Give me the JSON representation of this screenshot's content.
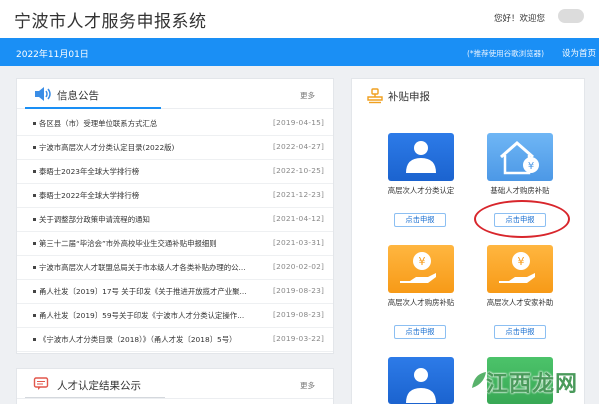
{
  "header": {
    "site_title": "宁波市人才服务申报系统",
    "greeting": "您好！欢迎您"
  },
  "bluebar": {
    "date": "2022年11月01日",
    "browser_tip": "(*推荐使用谷歌浏览器)",
    "homepage_link": "设为首页"
  },
  "announcements": {
    "title": "信息公告",
    "more": "更多",
    "items": [
      {
        "title": "各区县（市）受理单位联系方式汇总",
        "date": "[2019-04-15]"
      },
      {
        "title": "宁波市高层次人才分类认定目录(2022版)",
        "date": "[2022-04-27]"
      },
      {
        "title": "泰晤士2023年全球大学排行榜",
        "date": "[2022-10-25]"
      },
      {
        "title": "泰晤士2022年全球大学排行榜",
        "date": "[2021-12-23]"
      },
      {
        "title": "关于调整部分政策申请流程的通知",
        "date": "[2021-04-12]"
      },
      {
        "title": "第三十二届“毕洽会”市外高校毕业生交通补贴申报细则",
        "date": "[2021-03-31]"
      },
      {
        "title": "宁波市高层次人才联盟总局关于市本级人才各类补贴办理的公...",
        "date": "[2020-02-02]"
      },
      {
        "title": "甬人社发〔2019〕17号 关于印发《关于推进开放揽才产业聚...",
        "date": "[2019-08-23]"
      },
      {
        "title": "甬人社发〔2019〕59号关于印发《宁波市人才分类认定操作...",
        "date": "[2019-08-23]"
      },
      {
        "title": "《宁波市人才分类目录（2018）》（甬人才发〔2018〕5号）",
        "date": "[2019-03-22]"
      }
    ]
  },
  "results": {
    "title": "人才认定结果公示",
    "more": "更多"
  },
  "subsidy": {
    "title": "补贴申报",
    "tiles": [
      {
        "label": "高层次人才分类认定",
        "button": "点击申报",
        "icon": "person-icon",
        "color": "#2d7be8"
      },
      {
        "label": "基础人才购房补贴",
        "button": "点击申报",
        "icon": "house-yen-icon",
        "color": "#6fb6f5"
      },
      {
        "label": "高层次人才购房补贴",
        "button": "点击申报",
        "icon": "hand-yen-icon",
        "color": "#f79a17"
      },
      {
        "label": "高层次人才安家补助",
        "button": "点击申报",
        "icon": "hand-yen-icon",
        "color": "#f79a17"
      }
    ]
  },
  "annotation": {
    "color": "#d8262c"
  },
  "watermark": {
    "text": "江西龙网"
  },
  "colors": {
    "accent": "#1a8ff5",
    "orange": "#f79a17"
  }
}
